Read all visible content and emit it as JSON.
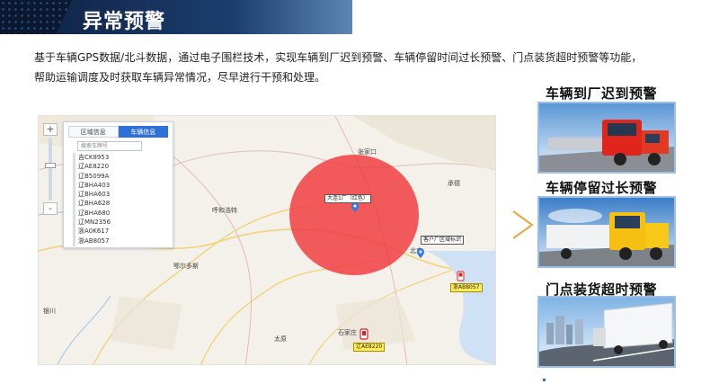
{
  "header": {
    "title": "异常预警"
  },
  "description": {
    "line1": "基于车辆GPS数据/北斗数据，通过电子围栏技术，实现车辆到厂迟到预警、车辆停留时间过长预警、门点装货超时预警等功能，",
    "line2": "帮助运输调度及时获取车辆异常情况，尽早进行干预和处理。"
  },
  "map_panel": {
    "tabs": [
      {
        "label": "区域信息",
        "active": false
      },
      {
        "label": "车辆信息",
        "active": true
      }
    ],
    "search_placeholder": "搜索车牌号",
    "vehicles": [
      "吉CK8953",
      "辽AE8220",
      "辽B5099A",
      "辽BHA403",
      "辽BHA603",
      "辽BHA628",
      "辽BHA680",
      "辽MN2356",
      "浙A0K617",
      "浙AB8057"
    ],
    "zoom_in": "+",
    "zoom_out": "-"
  },
  "map_labels": {
    "region_tag": "大连1厂（红色）",
    "region_tag2": "客户厂区域标识",
    "vehicle_tag1": "浙AB8057",
    "vehicle_tag2": "辽AE8220",
    "cities": {
      "hohhot": "呼和浩特",
      "beijing": "北京",
      "taiyuan": "太原",
      "shijiazhuang": "石家庄",
      "yinchuan": "银川",
      "erdos": "鄂尔多斯",
      "zhangjiakou": "张家口",
      "chengde": "承德"
    }
  },
  "cards": [
    {
      "title": "车辆到厂迟到预警",
      "image": "red-truck"
    },
    {
      "title": "车辆停留过长预警",
      "image": "yellow-truck"
    },
    {
      "title": "门点装货超时预警",
      "image": "white-truck-city"
    }
  ],
  "colors": {
    "accent": "#1b3e6e",
    "circle": "#f0373c",
    "card_border": "#9ac0e6"
  }
}
